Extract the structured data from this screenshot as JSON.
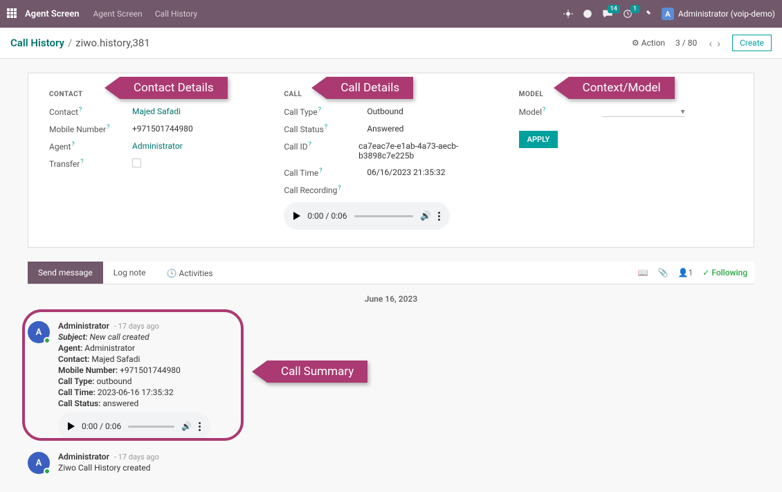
{
  "topbar": {
    "title": "Agent Screen",
    "nav": [
      "Agent Screen",
      "Call History"
    ],
    "msg_badge": "14",
    "clock_badge": "1",
    "user_initial": "A",
    "user_label": "Administrator (voip-demo)"
  },
  "breadcrumb": {
    "root": "Call History",
    "current": "ziwo.history,381",
    "action": "Action",
    "pager": "3 / 80",
    "create": "Create"
  },
  "contact": {
    "section": "CONTACT",
    "labels": {
      "contact": "Contact",
      "mobile": "Mobile Number",
      "agent": "Agent",
      "transfer": "Transfer"
    },
    "contact": "Majed Safadi",
    "mobile": "+971501744980",
    "agent": "Administrator"
  },
  "call": {
    "section": "CALL",
    "labels": {
      "type": "Call Type",
      "status": "Call Status",
      "id": "Call ID",
      "time": "Call Time",
      "recording": "Call Recording"
    },
    "type": "Outbound",
    "status": "Answered",
    "id": "ca7eac7e-e1ab-4a73-aecb-b3898c7e225b",
    "time": "06/16/2023 21:35:32",
    "audio": "0:00 / 0:06"
  },
  "model": {
    "section": "MODEL",
    "label": "Model",
    "apply": "APPLY"
  },
  "callouts": {
    "contact": "Contact Details",
    "call": "Call Details",
    "model": "Context/Model",
    "summary": "Call Summary"
  },
  "chatter": {
    "send": "Send message",
    "log": "Log note",
    "activities": "Activities",
    "followers": "1",
    "following": "Following",
    "date": "June 16, 2023"
  },
  "msg1": {
    "author": "Administrator",
    "time": "- 17 days ago",
    "subject_l": "Subject:",
    "subject_v": "New call created",
    "agent_l": "Agent:",
    "agent_v": "Administrator",
    "contact_l": "Contact:",
    "contact_v": "Majed Safadi",
    "mobile_l": "Mobile Number:",
    "mobile_v": "+971501744980",
    "type_l": "Call Type:",
    "type_v": "outbound",
    "time_l": "Call Time:",
    "time_v": "2023-06-16 17:35:32",
    "status_l": "Call Status:",
    "status_v": "answered",
    "audio": "0:00 / 0:06"
  },
  "msg2": {
    "author": "Administrator",
    "time": "- 17 days ago",
    "body": "Ziwo Call History created"
  }
}
